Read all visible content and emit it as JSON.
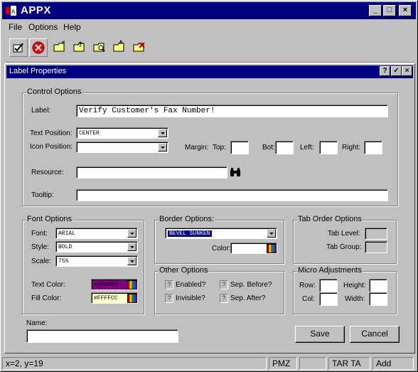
{
  "app": {
    "title": "APPX",
    "window_controls": [
      "_",
      "□",
      "×"
    ]
  },
  "menu": [
    "File",
    "Options",
    "Help"
  ],
  "toolbar": {
    "buttons": [
      "check-icon",
      "cancel-icon",
      "folder-new-icon",
      "folder-up-icon",
      "folder-search-icon",
      "folder-add-icon",
      "folder-delete-icon"
    ]
  },
  "dialog": {
    "title": "Label Properties",
    "controls": [
      "?",
      "✓",
      "×"
    ],
    "control_options": {
      "legend": "Control Options",
      "label_label": "Label:",
      "label_value": "Verify Customer's Fax Number!",
      "text_position_label": "Text Position:",
      "text_position_value": "CENTER",
      "icon_position_label": "Icon Position:",
      "icon_position_value": "",
      "margin_label": "Margin:",
      "top_label": "Top:",
      "bot_label": "Bot:",
      "left_label": "Left:",
      "right_label": "Right:",
      "resource_label": "Resource:",
      "resource_value": "",
      "tooltip_label": "Tooltip:",
      "tooltip_value": ""
    },
    "font_options": {
      "legend": "Font Options",
      "font_label": "Font:",
      "font_value": "ARIAL",
      "style_label": "Style:",
      "style_value": "BOLD",
      "scale_label": "Scale:",
      "scale_value": "75%",
      "text_color_label": "Text Color:",
      "text_color_value": "#800080",
      "text_color_hex": "#800080",
      "fill_color_label": "Fill Color:",
      "fill_color_value": "#FFFFCC",
      "fill_color_hex": "#FFFFCC"
    },
    "border_options": {
      "legend": "Border Options:",
      "border_value": "BEVEL SUNKEN",
      "color_label": "Color:",
      "color_value": ""
    },
    "tab_order_options": {
      "legend": "Tab Order Options",
      "tab_level_label": "Tab Level:",
      "tab_group_label": "Tab Group:"
    },
    "other_options": {
      "legend": "Other Options",
      "enabled_label": "Enabled?",
      "invisible_label": "Invisible?",
      "sep_before_label": "Sep. Before?",
      "sep_after_label": "Sep. After?",
      "check_glyph": "?"
    },
    "micro_adjustments": {
      "legend": "Micro Adjustments",
      "row_label": "Row:",
      "height_label": "Height:",
      "col_label": "Col:",
      "width_label": "Width:"
    },
    "name_label": "Name:",
    "name_value": "",
    "save_label": "Save",
    "cancel_label": "Cancel"
  },
  "status": {
    "coords": "x=2, y=19",
    "mode": "PMZ",
    "tar": "TAR TA",
    "add": "Add"
  },
  "colors": {
    "title_bar": "#000080",
    "face": "#c0c0c0"
  }
}
